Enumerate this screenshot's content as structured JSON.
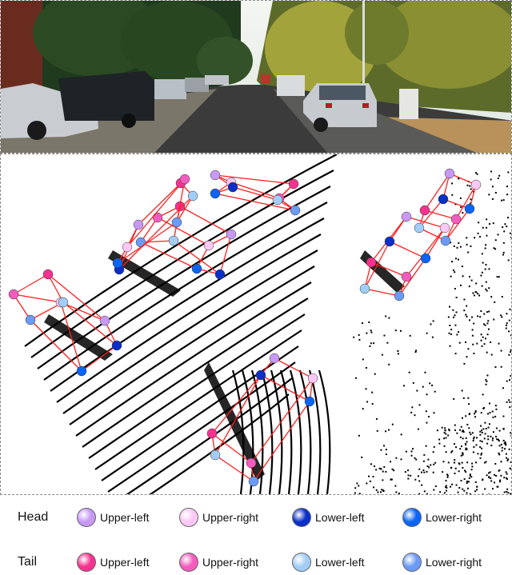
{
  "figure": {
    "photo": {
      "description": "Street scene camera image with parked cars on both sides"
    },
    "point_cloud": {
      "description": "LiDAR point cloud with 3D bounding boxes; box corners marked with colored spheres"
    }
  },
  "legend": {
    "rows": [
      {
        "label": "Head",
        "items": [
          {
            "label": "Upper-left",
            "color": "#c799f5"
          },
          {
            "label": "Upper-right",
            "color": "#fbc8f5"
          },
          {
            "label": "Lower-left",
            "color": "#0a2fc9"
          },
          {
            "label": "Lower-right",
            "color": "#0a64f5"
          }
        ]
      },
      {
        "label": "Tail",
        "items": [
          {
            "label": "Upper-left",
            "color": "#f5328f"
          },
          {
            "label": "Upper-right",
            "color": "#f25cbe"
          },
          {
            "label": "Lower-left",
            "color": "#a2cdf7"
          },
          {
            "label": "Lower-right",
            "color": "#6b9bf5"
          }
        ]
      }
    ]
  },
  "colors": {
    "box_edge": "#ff2020",
    "points": "#000000"
  }
}
